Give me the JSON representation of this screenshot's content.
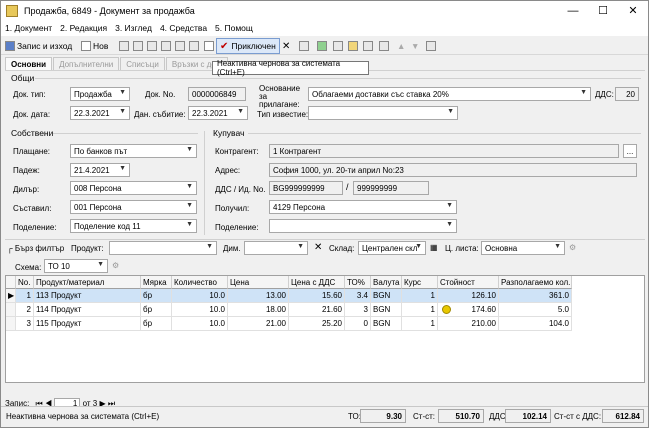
{
  "window": {
    "title": "Продажба, 6849 - Документ за продажба"
  },
  "menu": [
    "1. Документ",
    "2. Редакция",
    "3. Изглед",
    "4. Средства",
    "5. Помощ"
  ],
  "toolbar": {
    "save_exit": "Запис и изход",
    "new": "Нов",
    "complete": "Приключен"
  },
  "tabs": [
    "Основни",
    "Допълнителни",
    "Списъци",
    "Връзки с док."
  ],
  "tooltip": "Неактивна чернова за системата (Ctrl+E)",
  "general": {
    "group_title": "Общи",
    "doc_type_label": "Док. тип:",
    "doc_type": "Продажба",
    "doc_no_label": "Док. No.",
    "doc_no": "0000006849",
    "basis_label": "Основание за прилагане:",
    "basis": "Облагаеми доставки със ставка 20%",
    "vat_label": "ДДС:",
    "vat": "20",
    "doc_date_label": "Док. дата:",
    "doc_date": "22.3.2021",
    "event_date_label": "Дан. събитие:",
    "event_date": "22.3.2021",
    "notice_type_label": "Тип известие:",
    "notice_type": ""
  },
  "own": {
    "group_title": "Собствени",
    "payment_label": "Плащане:",
    "payment": "По банков път",
    "due_label": "Падеж:",
    "due": "21.4.2021",
    "dealer_label": "Дилър:",
    "dealer": "008 Персона",
    "creator_label": "Съставил:",
    "creator": "001 Персона",
    "division_label": "Поделение:",
    "division": "Поделение код 11"
  },
  "buyer": {
    "group_title": "Купувач",
    "contractor_label": "Контрагент:",
    "contractor": "1 Контрагент",
    "address_label": "Адрес:",
    "address": "София 1000, ул. 20-ти април No:23",
    "vat_id_label": "ДДС / Ид. No.",
    "vat_id": "BG999999999",
    "id_no": "999999999",
    "receiver_label": "Получил:",
    "receiver": "4129 Персона",
    "division_label": "Поделение:",
    "division": ""
  },
  "filter": {
    "quick_filter": "Бърз филтър",
    "product_label": "Продукт:",
    "dim_label": "Дим.",
    "warehouse_label": "Склад:",
    "warehouse": "Централен скл",
    "pricelist_label": "Ц. листа:",
    "pricelist": "Основна",
    "scheme_label": "Схема:",
    "scheme": "ТО 10"
  },
  "table": {
    "columns": [
      "No.",
      "Продукт/материал",
      "Мярка",
      "Количество",
      "Цена",
      "Цена с ДДС",
      "ТО%",
      "Валута",
      "Курс",
      "Стойност",
      "Разполагаемо кол."
    ],
    "rows": [
      [
        "1",
        "113 Продукт",
        "бр",
        "10.0",
        "13.00",
        "15.60",
        "3.4",
        "BGN",
        "1",
        "126.10",
        "361.0"
      ],
      [
        "2",
        "114 Продукт",
        "бр",
        "10.0",
        "18.00",
        "21.60",
        "3",
        "BGN",
        "1",
        "174.60",
        "5.0"
      ],
      [
        "3",
        "115 Продукт",
        "бр",
        "10.0",
        "21.00",
        "25.20",
        "0",
        "BGN",
        "1",
        "210.00",
        "104.0"
      ]
    ]
  },
  "pager": {
    "label": "Запис:",
    "current": "1",
    "of": "от 3"
  },
  "status": {
    "text": "Неактивна чернова за системата (Ctrl+E)",
    "to_label": "ТО:",
    "to": "9.30",
    "st_label": "Ст-ст:",
    "st": "510.70",
    "vat_label": "ДДС:",
    "vat": "102.14",
    "total_label": "Ст-ст с ДДС:",
    "total": "612.84"
  },
  "colors": {
    "selected_row": "#cfe3f7",
    "warning_icon": "#e8c800"
  }
}
